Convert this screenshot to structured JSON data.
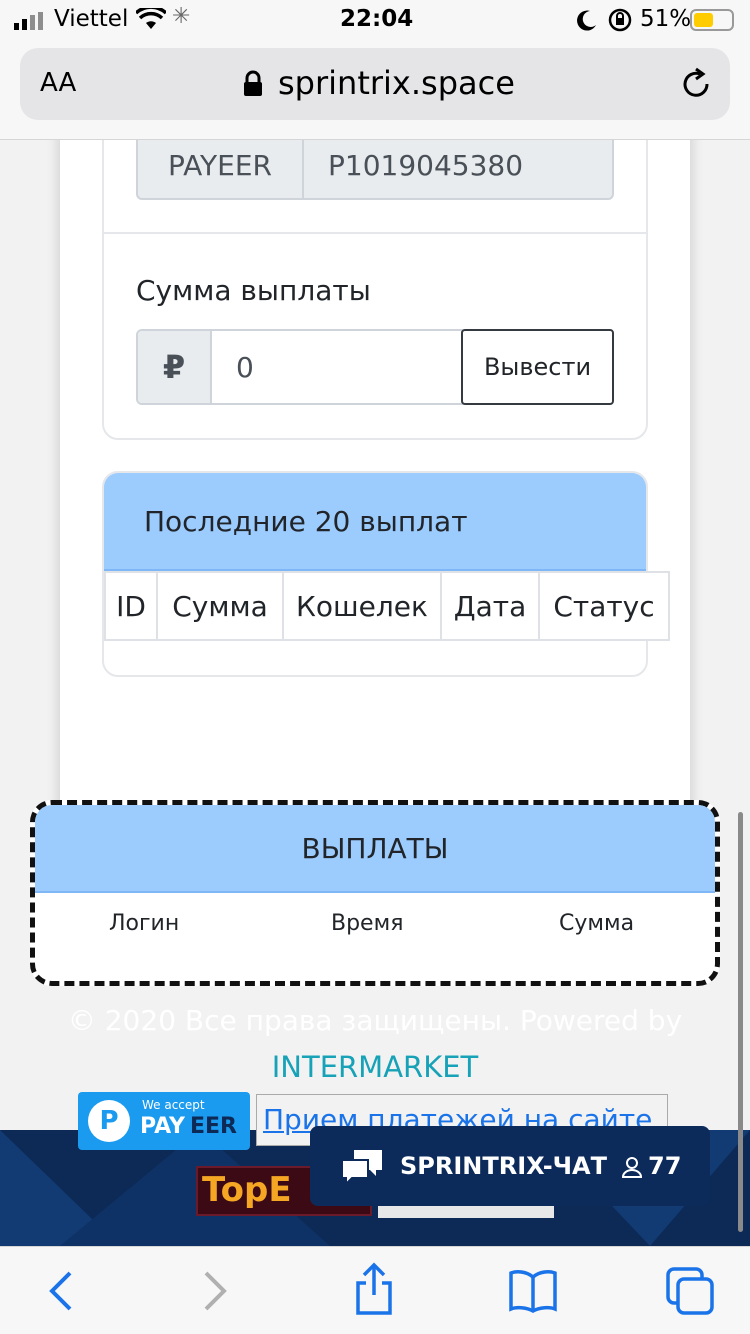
{
  "status_bar": {
    "carrier": "Viettel",
    "time": "22:04",
    "battery": "51%"
  },
  "browser": {
    "text_size_label": "AA",
    "url": "sprintrix.space"
  },
  "wallet": {
    "system": "PAYEER",
    "account": "P1019045380"
  },
  "withdraw": {
    "label": "Сумма выплаты",
    "currency_symbol": "₽",
    "amount_value": "0",
    "submit_label": "Вывести"
  },
  "recent": {
    "title": "Последние 20 выплат",
    "columns": [
      "ID",
      "Сумма",
      "Кошелек",
      "Дата",
      "Статус"
    ]
  },
  "payouts": {
    "title": "ВЫПЛАТЫ",
    "columns": [
      "Логин",
      "Время",
      "Сумма"
    ]
  },
  "footer": {
    "copyright": "© 2020 Все права защищены. Powered by",
    "brand_link": "INTERMARKET",
    "payeer_badge_top": "We accept",
    "payeer_badge_brand_a": "PAY",
    "payeer_badge_brand_b": "EER",
    "payment_link": "Прием платежей на сайте",
    "topbanner_text": "TopE"
  },
  "chat": {
    "title": "SPRINTRIX-ЧАТ",
    "online_count": "77"
  },
  "colors": {
    "header_blue": "#9ccbfd",
    "brand_teal": "#17a2b8",
    "banner_navy": "#0c2a55",
    "ios_blue": "#1a73e8"
  }
}
